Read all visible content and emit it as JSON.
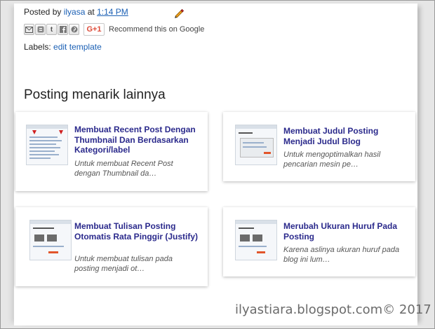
{
  "post_meta": {
    "posted_by_label": "Posted by",
    "author": "ilyasa",
    "at_label": "at",
    "time": "1:14 PM"
  },
  "share": {
    "buttons": [
      "email-icon",
      "blogger-icon",
      "twitter-icon",
      "facebook-icon",
      "pinterest-icon"
    ],
    "gplus_label": "G+1",
    "recommend_text": "Recommend this on Google"
  },
  "labels": {
    "prefix": "Labels:",
    "value": "edit template"
  },
  "related": {
    "heading": "Posting menarik lainnya",
    "items": [
      {
        "title": "Membuat Recent Post Dengan Thumbnail Dan Berdasarkan Kategori/label",
        "snippet": "Untuk membuat Recent Post dengan Thumbnail da…"
      },
      {
        "title": "Membuat Judul Posting Menjadi Judul Blog",
        "snippet": "Untuk mengoptimalkan hasil pencarian mesin pe…"
      },
      {
        "title": "Membuat Tulisan Posting Otomatis Rata Pinggir (Justify)",
        "snippet": "Untuk membuat tulisan pada posting menjadi ot…"
      },
      {
        "title": "Merubah Ukuran Huruf Pada Posting",
        "snippet": "Karena aslinya ukuran huruf pada blog ini lum…"
      }
    ]
  },
  "watermark": "ilyastiara.blogspot.com© 2017",
  "colors": {
    "link": "#1a5fb4",
    "card_title": "#2b2a8c",
    "gplus": "#dd4b39"
  }
}
